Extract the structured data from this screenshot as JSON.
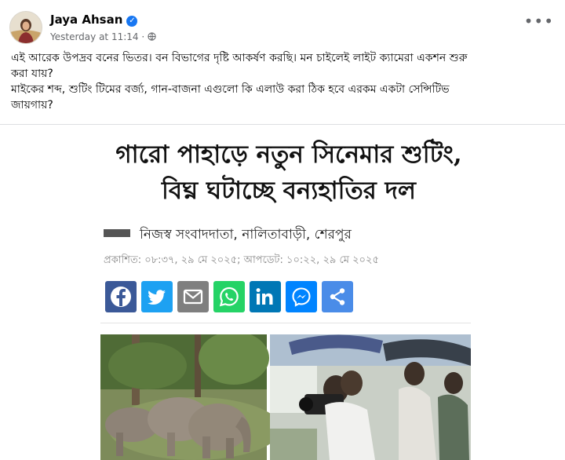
{
  "post": {
    "author": "Jaya Ahsan",
    "timestamp": "Yesterday at 11:14",
    "privacy_icon": "globe-icon",
    "text_lines": [
      "এই আরেক উপদ্রব বনের ভিতর। বন বিভাগের দৃষ্টি আকর্ষণ করছি। মন চাইলেই লাইট ক্যামেরা একশন শুরু",
      "করা যায়?",
      "মাইকের শব্দ, শুটিং টিমের বর্জ্য, গান-বাজনা এগুলো কি এলাউ করা ঠিক হবে এরকম একটা সেন্সিটিভ",
      "জায়গায়?"
    ]
  },
  "article": {
    "headline_lines": [
      "গারো পাহাড়ে নতুন সিনেমার শুটিং,",
      "বিঘ্ন ঘটাচ্ছে বন্যহাতির দল"
    ],
    "byline": "নিজস্ব সংবাদদাতা, নালিতাবাড়ী, শেরপুর",
    "published": "প্রকাশিত: ০৮:৩৭, ২৯ মে ২০২৫; আপডেট: ১০:২২, ২৯ মে ২০২৫",
    "share_buttons": [
      {
        "name": "facebook-share-button",
        "icon": "facebook-icon",
        "color": "#3b5998"
      },
      {
        "name": "twitter-share-button",
        "icon": "twitter-icon",
        "color": "#1da1f2"
      },
      {
        "name": "email-share-button",
        "icon": "envelope-icon",
        "color": "#7f7f7f"
      },
      {
        "name": "whatsapp-share-button",
        "icon": "whatsapp-icon",
        "color": "#25d366"
      },
      {
        "name": "linkedin-share-button",
        "icon": "linkedin-icon",
        "color": "#0077b5"
      },
      {
        "name": "messenger-share-button",
        "icon": "messenger-icon",
        "color": "#0084ff"
      },
      {
        "name": "more-share-button",
        "icon": "share-icon",
        "color": "#4a8ce8"
      }
    ]
  },
  "colors": {
    "verified": "#1877f2",
    "text": "#050505",
    "meta": "#65676b"
  }
}
